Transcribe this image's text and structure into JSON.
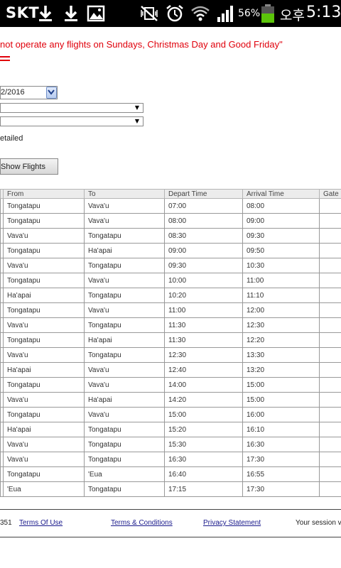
{
  "status_bar": {
    "carrier": "SKT",
    "battery_percent": "56%",
    "battery_level": 0.56,
    "ampm": "오후",
    "time": "5:13",
    "icons": [
      "download-icon",
      "download-icon",
      "image-icon",
      "mute-vibrate-icon",
      "alarm-icon",
      "wifi-icon",
      "signal-icon",
      "battery-icon"
    ],
    "battery_color": "#5bc40a"
  },
  "notice": "not operate any flights on Sundays, Christmas Day and Good Friday\"",
  "form": {
    "date_value": "2/2016",
    "option_label": "etailed",
    "show_button": "Show Flights"
  },
  "table": {
    "headers": [
      "From",
      "To",
      "Depart Time",
      "Arrival Time",
      "Gate N"
    ],
    "rows": [
      [
        "Tongatapu",
        "Vava'u",
        "07:00",
        "08:00"
      ],
      [
        "Tongatapu",
        "Vava'u",
        "08:00",
        "09:00"
      ],
      [
        "Vava'u",
        "Tongatapu",
        "08:30",
        "09:30"
      ],
      [
        "Tongatapu",
        "Ha'apai",
        "09:00",
        "09:50"
      ],
      [
        "Vava'u",
        "Tongatapu",
        "09:30",
        "10:30"
      ],
      [
        "Tongatapu",
        "Vava'u",
        "10:00",
        "11:00"
      ],
      [
        "Ha'apai",
        "Tongatapu",
        "10:20",
        "11:10"
      ],
      [
        "Tongatapu",
        "Vava'u",
        "11:00",
        "12:00"
      ],
      [
        "Vava'u",
        "Tongatapu",
        "11:30",
        "12:30"
      ],
      [
        "Tongatapu",
        "Ha'apai",
        "11:30",
        "12:20"
      ],
      [
        "Vava'u",
        "Tongatapu",
        "12:30",
        "13:30"
      ],
      [
        "Ha'apai",
        "Vava'u",
        "12:40",
        "13:20"
      ],
      [
        "Tongatapu",
        "Vava'u",
        "14:00",
        "15:00"
      ],
      [
        "Vava'u",
        "Ha'apai",
        "14:20",
        "15:00"
      ],
      [
        "Tongatapu",
        "Vava'u",
        "15:00",
        "16:00"
      ],
      [
        "Ha'apai",
        "Tongatapu",
        "15:20",
        "16:10"
      ],
      [
        "Vava'u",
        "Tongatapu",
        "15:30",
        "16:30"
      ],
      [
        "Vava'u",
        "Tongatapu",
        "16:30",
        "17:30"
      ],
      [
        "Tongatapu",
        "'Eua",
        "16:40",
        "16:55"
      ],
      [
        "'Eua",
        "Tongatapu",
        "17:15",
        "17:30"
      ]
    ]
  },
  "footer": {
    "code": "351",
    "terms_of_use": "Terms Of Use",
    "terms_conditions": "Terms & Conditions",
    "privacy": "Privacy Statement",
    "session": "Your session v"
  },
  "colors": {
    "notice_red": "#e0000b",
    "link_blue": "#1a1a8c",
    "header_bg": "#ececec"
  }
}
